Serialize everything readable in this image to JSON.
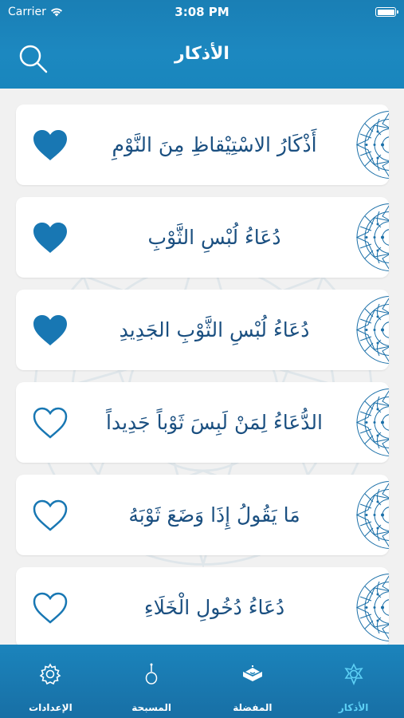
{
  "status_bar": {
    "carrier": "Carrier",
    "time": "3:08 PM"
  },
  "header": {
    "title": "الأذكار",
    "search_icon": "search-icon"
  },
  "items": [
    {
      "title": "أَذْكَارُ الاسْتِيْقاظِ مِنَ النَّوْمِ",
      "favorite": true
    },
    {
      "title": "دُعَاءُ لُبْسِ الثَّوْبِ",
      "favorite": true
    },
    {
      "title": "دُعَاءُ لُبْسِ الثَّوْبِ الجَدِيدِ",
      "favorite": true
    },
    {
      "title": "الدُّعَاءُ لِمَنْ لَبِسَ ثَوْباً جَدِيداً",
      "favorite": false
    },
    {
      "title": "مَا يَقُولُ إِذَا وَضَعَ ثَوْبَهُ",
      "favorite": false
    },
    {
      "title": "دُعَاءُ دُخُولِ الْخَلَاءِ",
      "favorite": false
    }
  ],
  "tabbar": {
    "tabs": [
      {
        "label": "الأذكار",
        "icon": "adhkar-icon",
        "active": true
      },
      {
        "label": "المفضلة",
        "icon": "favorites-quran-icon",
        "active": false
      },
      {
        "label": "المسبحة",
        "icon": "tasbih-icon",
        "active": false
      },
      {
        "label": "الإعدادات",
        "icon": "settings-gear-icon",
        "active": false
      }
    ]
  },
  "colors": {
    "header": "#1a7fb5",
    "heart_fill": "#1877b3",
    "title_text": "#1a4f80",
    "active_tab": "#5dd0f5"
  }
}
